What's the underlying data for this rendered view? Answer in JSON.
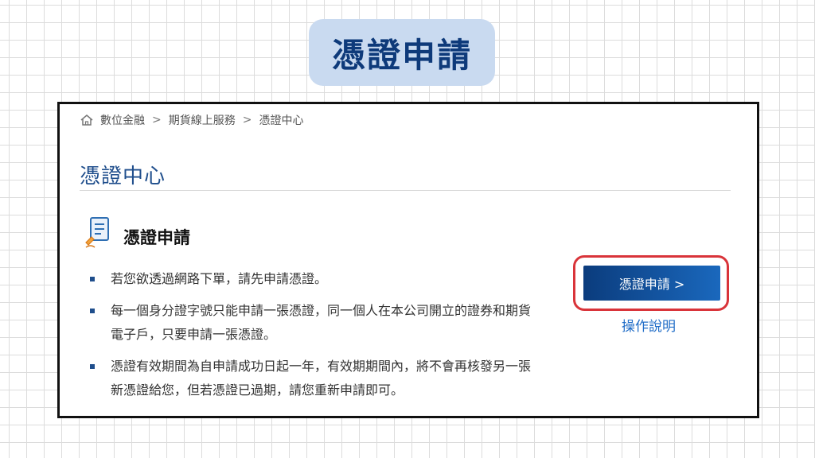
{
  "banner": {
    "title": "憑證申請"
  },
  "breadcrumb": {
    "items": [
      "數位金融",
      "期貨線上服務",
      "憑證中心"
    ],
    "separator": ">"
  },
  "page": {
    "title": "憑證中心"
  },
  "section": {
    "icon": "certificate-document-icon",
    "title": "憑證申請",
    "bullets": [
      "若您欲透過網路下單，請先申請憑證。",
      "每一個身分證字號只能申請一張憑證，同一個人在本公司開立的證券和期貨電子戶，只要申請一張憑證。",
      "憑證有效期間為自申請成功日起一年，有效期期間內，將不會再核發另一張新憑證給您，但若憑證已過期，請您重新申請即可。"
    ]
  },
  "actions": {
    "apply_button": "憑證申請 >",
    "help_link": "操作說明"
  },
  "colors": {
    "banner_bg": "#c9daf0",
    "banner_text": "#0e3a7a",
    "accent_blue": "#1f4e8c",
    "button_blue": "#0b3c7d",
    "link_blue": "#1f6cc7",
    "highlight_red": "#d9343a"
  }
}
